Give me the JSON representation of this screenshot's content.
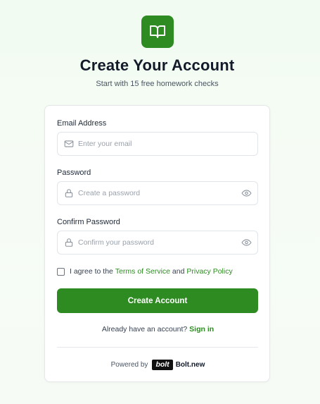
{
  "logo": {
    "icon": "book-open-icon",
    "color": "#2e8b22"
  },
  "header": {
    "title": "Create Your Account",
    "subtitle": "Start with 15 free homework checks"
  },
  "form": {
    "email": {
      "label": "Email Address",
      "placeholder": "Enter your email",
      "value": "",
      "icon": "mail-icon"
    },
    "password": {
      "label": "Password",
      "placeholder": "Create a password",
      "value": "",
      "icon": "lock-icon",
      "toggle_icon": "eye-icon"
    },
    "confirm": {
      "label": "Confirm Password",
      "placeholder": "Confirm your password",
      "value": "",
      "icon": "lock-icon",
      "toggle_icon": "eye-icon"
    },
    "terms": {
      "prefix": "I agree to the",
      "tos": "Terms of Service",
      "and": "and",
      "privacy": "Privacy Policy",
      "checked": false
    },
    "submit_label": "Create Account"
  },
  "signin": {
    "text": "Already have an account?",
    "link": "Sign in"
  },
  "footer": {
    "powered_by": "Powered by",
    "badge": "bolt",
    "brand": "Bolt.new"
  },
  "colors": {
    "accent": "#2e8b22",
    "text": "#141a29",
    "muted": "#9aa1ac"
  }
}
